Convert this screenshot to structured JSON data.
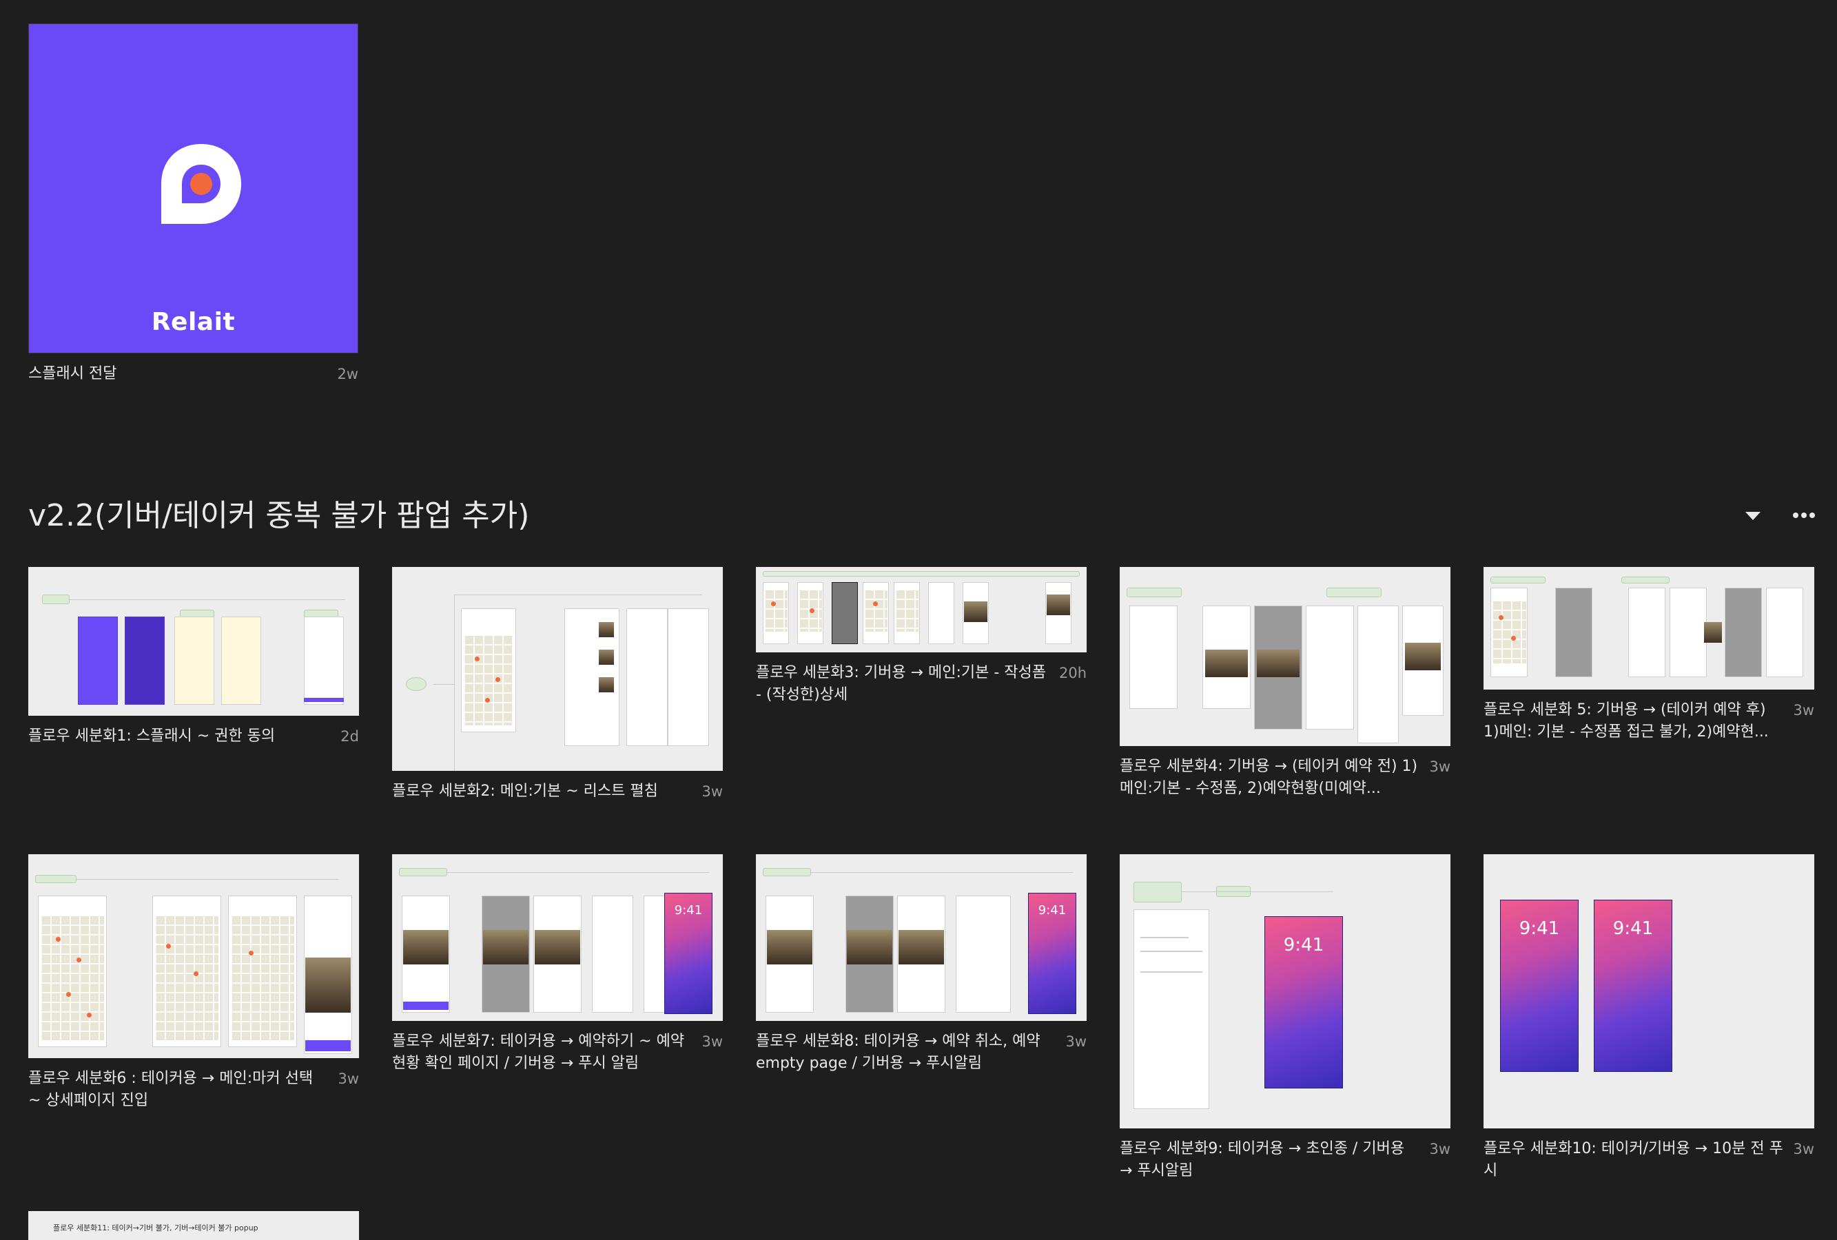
{
  "splash": {
    "brand": "Relait",
    "title": "스플래시 전달",
    "time": "2w",
    "accent": "#6a4af7",
    "dot": "#f26a3c"
  },
  "section": {
    "title": "v2.2(기버/테이커 중복 불가 팝업 추가)",
    "icons": [
      "chevron-down-icon",
      "more-icon"
    ]
  },
  "cards": [
    {
      "title": "플로우 세분화1: 스플래시 ~ 권한 동의",
      "time": "2d"
    },
    {
      "title": "플로우 세분화2: 메인:기본 ~ 리스트 펼침",
      "time": "3w"
    },
    {
      "title": "플로우 세분화3: 기버용 → 메인:기본 - 작성폼 - (작성한)상세",
      "time": "20h"
    },
    {
      "title": "플로우 세분화4: 기버용 → (테이커 예약 전) 1)메인:기본 - 수정폼, 2)예약현황(미예약...",
      "time": "3w"
    },
    {
      "title": "플로우 세분화 5: 기버용 → (테이커 예약 후) 1)메인: 기본 - 수정폼 접근 불가, 2)예약현...",
      "time": "3w"
    },
    {
      "title": "플로우 세분화6 : 테이커용 → 메인:마커 선택 ~ 상세페이지 진입",
      "time": "3w"
    },
    {
      "title": "플로우 세분화7: 테이커용 → 예약하기 ~ 예약현황 확인 페이지 / 기버용 → 푸시 알림",
      "time": "3w"
    },
    {
      "title": "플로우 세분화8: 테이커용 → 예약 취소, 예약 empty page / 기버용 → 푸시알림",
      "time": "3w"
    },
    {
      "title": "플로우 세분화9: 테이커용 → 초인종 / 기버용 → 푸시알림",
      "time": "3w"
    },
    {
      "title": "플로우 세분화10: 테이커/기버용 → 10분 전 푸시",
      "time": "3w"
    },
    {
      "title": "플로우 세분화11: 테이커→기버 불가, 기버→테이커 불가 popup",
      "time": ""
    }
  ],
  "lock_time": "9:41"
}
